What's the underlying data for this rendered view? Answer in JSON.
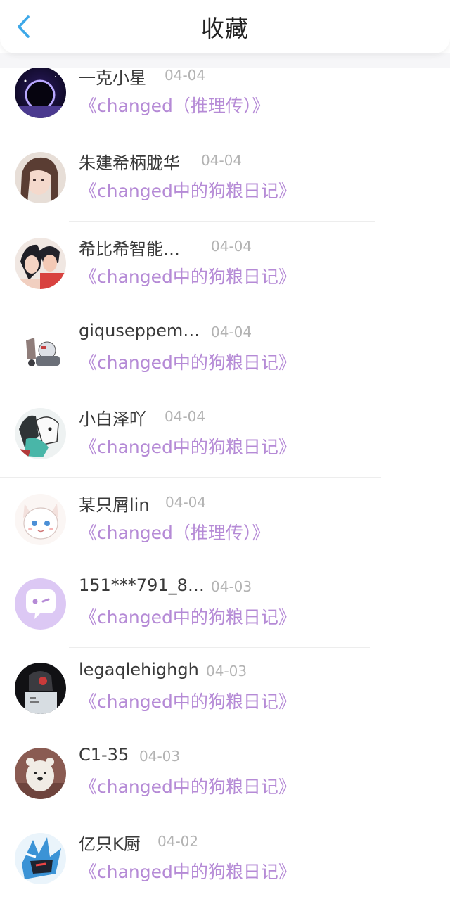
{
  "header": {
    "title": "收藏",
    "back_icon": "chevron-left-icon",
    "accent_color": "#3da8e8"
  },
  "colors": {
    "work_link": "#b58ad6",
    "date": "#b3b3b3",
    "name": "#3a3a3a"
  },
  "items": [
    {
      "name": "一克小星",
      "date": "04-04",
      "work": "《changed（推理传）》",
      "avatar": "avatar-galaxy-eclipse"
    },
    {
      "name": "朱建希柄胧华",
      "date": "04-04",
      "work": "《changed中的狗粮日记》",
      "avatar": "avatar-girl-portrait"
    },
    {
      "name": "希比希智能…",
      "date": "04-04",
      "work": "《changed中的狗粮日记》",
      "avatar": "avatar-anime-couple"
    },
    {
      "name": "giquseppem…",
      "date": "04-04",
      "work": "《changed中的狗粮日记》",
      "avatar": "avatar-robot-figure"
    },
    {
      "name": "小白泽吖",
      "date": "04-04",
      "work": "《changed中的狗粮日记》",
      "avatar": "avatar-sketch-animals"
    },
    {
      "name": "某只屑lin",
      "date": "04-04",
      "work": "《changed（推理传）》",
      "avatar": "avatar-white-fox-chibi"
    },
    {
      "name": "151***791_8…",
      "date": "04-03",
      "work": "《changed中的狗粮日记》",
      "avatar": "avatar-default-chat-bubble"
    },
    {
      "name": "legaqlehighgh",
      "date": "04-03",
      "work": "《changed中的狗粮日记》",
      "avatar": "avatar-dark-figurine"
    },
    {
      "name": "C1-35",
      "date": "04-03",
      "work": "《changed中的狗粮日记》",
      "avatar": "avatar-bear-cartoon"
    },
    {
      "name": "亿只K厨",
      "date": "04-02",
      "work": "《changed中的狗粮日记》",
      "avatar": "avatar-blue-beast"
    }
  ]
}
